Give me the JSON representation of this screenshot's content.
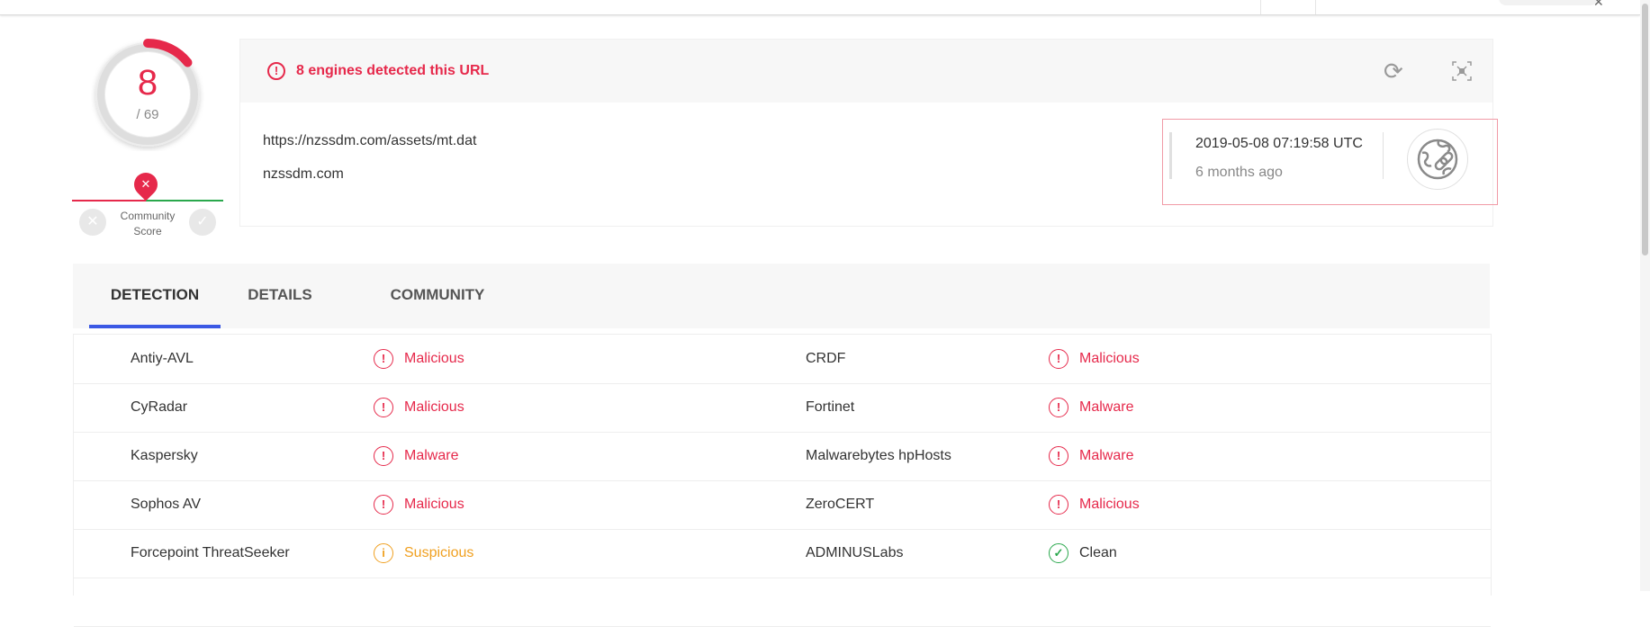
{
  "score": {
    "detected": "8",
    "total": "/ 69"
  },
  "community": {
    "label_line1": "Community",
    "label_line2": "Score"
  },
  "alert": {
    "text": "8 engines detected this URL"
  },
  "url": {
    "full": "https://nzssdm.com/assets/mt.dat",
    "domain": "nzssdm.com"
  },
  "analysis": {
    "date": "2019-05-08 07:19:58 UTC",
    "ago": "6 months ago"
  },
  "tabs": [
    {
      "label": "DETECTION"
    },
    {
      "label": "DETAILS"
    },
    {
      "label": "COMMUNITY"
    }
  ],
  "colors": {
    "malicious": "#e6294b",
    "suspicious": "#f0a020",
    "clean": "#2aa84d",
    "active_tab": "#3b59e4"
  },
  "detections": [
    {
      "left": {
        "engine": "Antiy-AVL",
        "result": "Malicious",
        "status": "malicious"
      },
      "right": {
        "engine": "CRDF",
        "result": "Malicious",
        "status": "malicious"
      }
    },
    {
      "left": {
        "engine": "CyRadar",
        "result": "Malicious",
        "status": "malicious"
      },
      "right": {
        "engine": "Fortinet",
        "result": "Malware",
        "status": "malicious"
      }
    },
    {
      "left": {
        "engine": "Kaspersky",
        "result": "Malware",
        "status": "malicious"
      },
      "right": {
        "engine": "Malwarebytes hpHosts",
        "result": "Malware",
        "status": "malicious"
      }
    },
    {
      "left": {
        "engine": "Sophos AV",
        "result": "Malicious",
        "status": "malicious"
      },
      "right": {
        "engine": "ZeroCERT",
        "result": "Malicious",
        "status": "malicious"
      }
    },
    {
      "left": {
        "engine": "Forcepoint ThreatSeeker",
        "result": "Suspicious",
        "status": "suspicious"
      },
      "right": {
        "engine": "ADMINUSLabs",
        "result": "Clean",
        "status": "clean"
      }
    }
  ]
}
